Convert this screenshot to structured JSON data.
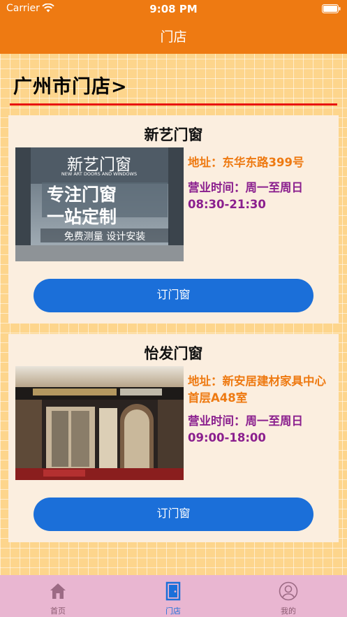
{
  "status_bar": {
    "carrier": "Carrier",
    "time": "9:08 PM"
  },
  "nav": {
    "title": "门店"
  },
  "city": {
    "title": "广州市门店>"
  },
  "stores": [
    {
      "name": "新艺门窗",
      "address": "地址：东华东路399号",
      "hours": "营业时间：周一至周日08:30-21:30",
      "button_label": "订门窗",
      "photo_text": {
        "title": "新艺门窗",
        "subtitle": "NEW ART DOORS AND WINDOWS",
        "line1": "专注门窗",
        "line2": "一站定制",
        "line3": "免费测量 设计安装"
      }
    },
    {
      "name": "怡发门窗",
      "address": "地址：新安居建材家具中心首层A48室",
      "hours": "营业时间：周一至周日09:00-18:00",
      "button_label": "订门窗"
    }
  ],
  "tabs": [
    {
      "label": "首页",
      "icon": "home-icon",
      "active": false
    },
    {
      "label": "门店",
      "icon": "door-icon",
      "active": true
    },
    {
      "label": "我的",
      "icon": "user-icon",
      "active": false
    }
  ],
  "colors": {
    "header": "#EE7A12",
    "address": "#EE7A12",
    "hours": "#8B1F8E",
    "button": "#1B6FD9",
    "tabbar": "#E9B6D1",
    "underline": "#E8110F"
  }
}
